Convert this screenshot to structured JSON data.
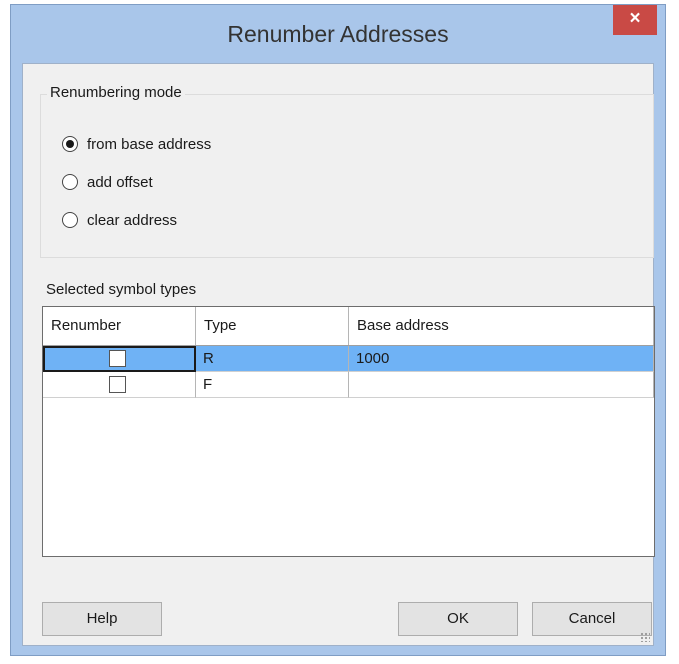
{
  "window": {
    "title": "Renumber Addresses",
    "close_symbol": "×"
  },
  "renumbering_mode": {
    "label": "Renumbering mode",
    "options": [
      {
        "label": "from base address",
        "selected": true
      },
      {
        "label": "add offset",
        "selected": false
      },
      {
        "label": "clear address",
        "selected": false
      }
    ]
  },
  "symbol_types": {
    "label": "Selected symbol types",
    "columns": [
      "Renumber",
      "Type",
      "Base address"
    ],
    "rows": [
      {
        "renumber": false,
        "type": "R",
        "base_address": "1000",
        "selected": true
      },
      {
        "renumber": false,
        "type": "F",
        "base_address": "",
        "selected": false
      }
    ]
  },
  "buttons": {
    "help": "Help",
    "ok": "OK",
    "cancel": "Cancel"
  },
  "colors": {
    "selection": "#6fb2f5",
    "close_button": "#c94a45",
    "frame": "#a9c6ea"
  }
}
